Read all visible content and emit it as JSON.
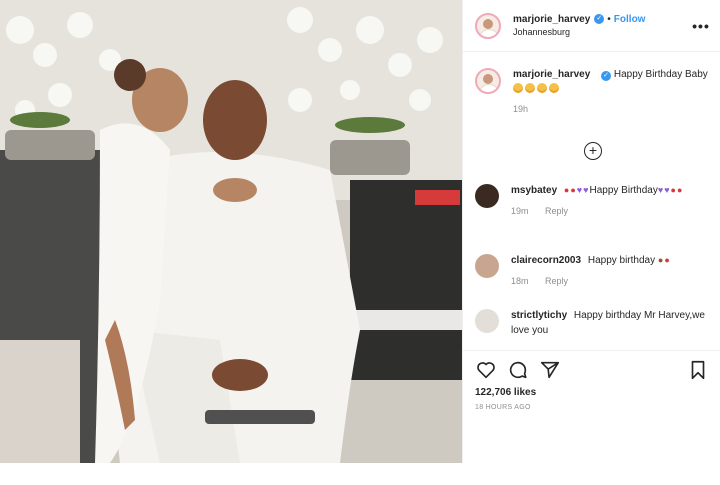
{
  "post": {
    "username": "marjorie_harvey",
    "location": "Johannesburg",
    "follow_label": "Follow",
    "dot": "•",
    "more": "•••"
  },
  "caption": {
    "username": "marjorie_harvey",
    "text": "Happy Birthday Baby",
    "emoji_count": 4,
    "time": "19h"
  },
  "comments": [
    {
      "username": "msybatey",
      "text_a": "Happy",
      "text_b": "Birthday",
      "time": "19m",
      "reply": "Reply"
    },
    {
      "username": "clairecorn2003",
      "text": "Happy birthday",
      "time": "18m",
      "reply": "Reply"
    },
    {
      "username": "strictlytichy",
      "text": "Happy birthday Mr Harvey,we love you"
    }
  ],
  "actions": {
    "likes": "122,706 likes",
    "ago": "18 HOURS AGO"
  },
  "icons": {
    "like": "heart-outline-icon",
    "comment": "comment-bubble-icon",
    "share": "paper-plane-icon",
    "save": "bookmark-icon",
    "load_more": "plus-circle-icon",
    "verified": "verified-badge-icon"
  },
  "colors": {
    "accent": "#3897f0",
    "text": "#262626",
    "muted": "#8e8e8e",
    "border": "#efefef"
  }
}
